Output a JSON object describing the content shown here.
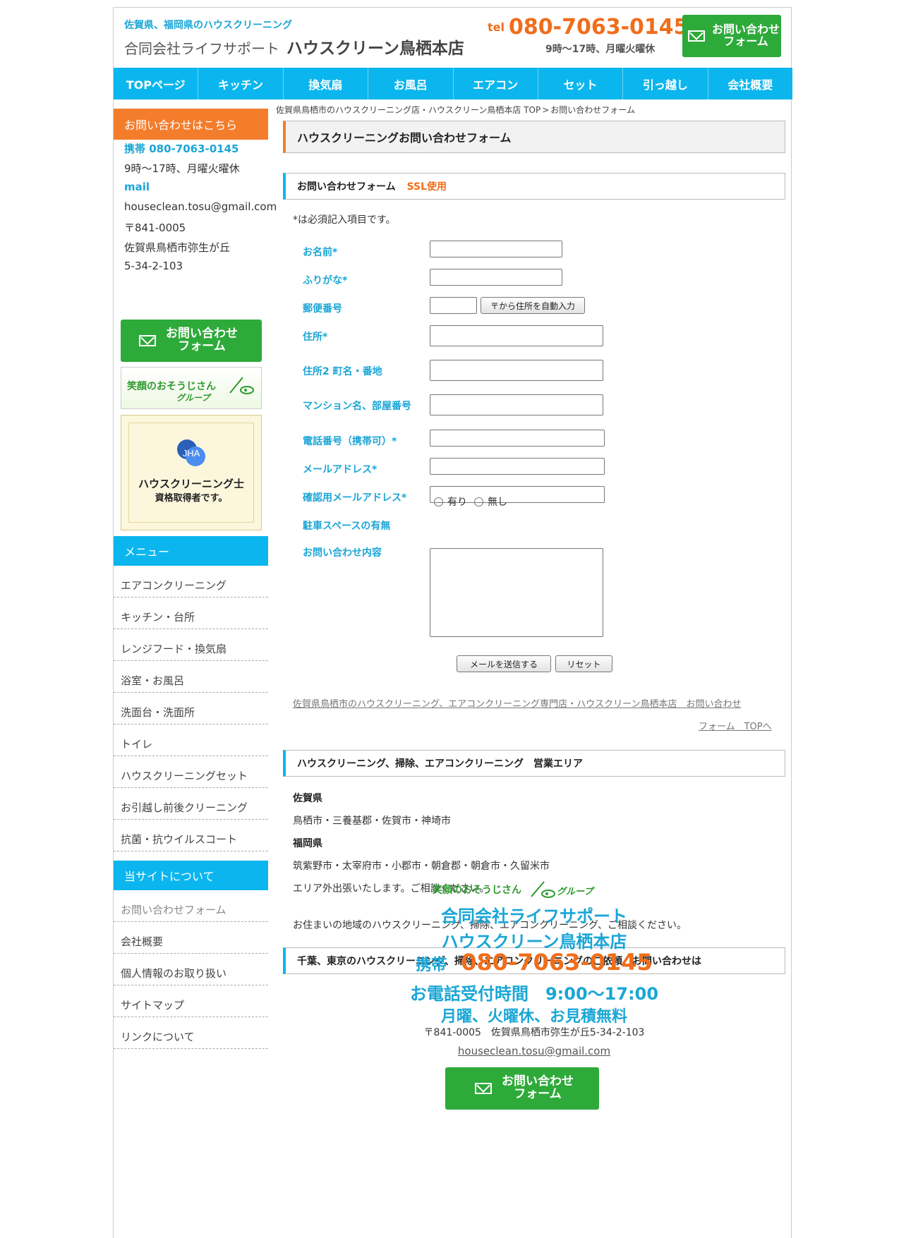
{
  "header": {
    "sub": "佐賀県、福岡県のハウスクリーニング",
    "company": "合同会社ライフサポート",
    "store": "ハウスクリーン鳥栖本店",
    "tel_prefix": "tel",
    "tel": "080-7063-0145",
    "hours": "9時～17時、月曜火曜休",
    "contact_btn": [
      "お問い合わせ",
      "フォーム"
    ]
  },
  "nav": [
    "TOPページ",
    "キッチン",
    "換気扇",
    "お風呂",
    "エアコン",
    "セット",
    "引っ越し",
    "会社概要"
  ],
  "sidebar": {
    "contact_head": "お問い合わせはこちら",
    "mobile": "携帯 080-7063-0145",
    "hours": "9時～17時、月曜火曜休",
    "mail_label": "mail",
    "email": "houseclean.tosu@gmail.com",
    "zip": "〒841-0005",
    "addr1": "佐賀県鳥栖市弥生が丘",
    "addr2": "5-34-2-103",
    "contact_btn": [
      "お問い合わせ",
      "フォーム"
    ],
    "banner1": {
      "main": "笑顔のおそうじさん",
      "sub": "グループ"
    },
    "banner2": {
      "logo": "JHA",
      "line1": "ハウスクリーニング士",
      "line2": "資格取得者です。"
    },
    "menu_head": "メニュー",
    "menu": [
      "エアコンクリーニング",
      "キッチン・台所",
      "レンジフード・換気扇",
      "浴室・お風呂",
      "洗面台・洗面所",
      "トイレ",
      "ハウスクリーニングセット",
      "お引越し前後クリーニング",
      "抗菌・抗ウイルスコート"
    ],
    "about_head": "当サイトについて",
    "about": [
      "お問い合わせフォーム",
      "会社概要",
      "個人情報のお取り扱い",
      "サイトマップ",
      "リンクについて"
    ]
  },
  "main": {
    "breadcrumb": [
      "佐賀県鳥栖市のハウスクリーニング店・ハウスクリーン鳥栖本店 TOP",
      "お問い合わせフォーム"
    ],
    "breadcrumb_sep": ">",
    "title": "ハウスクリーニングお問い合わせフォーム",
    "form_head": "お問い合わせフォーム",
    "ssl": "SSL使用",
    "req_note": "*は必須記入項目です。",
    "fields": {
      "name": "お名前*",
      "furigana": "ふりがな*",
      "zip": "郵便番号",
      "zip_btn": "〒から住所を自動入力",
      "addr": "住所*",
      "addr2": "住所2 町名・番地",
      "mansion": "マンション名、部屋番号",
      "tel": "電話番号（携帯可）*",
      "email": "メールアドレス*",
      "email_confirm": "確認用メールアドレス*",
      "parking": "駐車スペースの有無",
      "parking_yes": "有り",
      "parking_no": "無し",
      "message": "お問い合わせ内容"
    },
    "submit": "メールを送信する",
    "reset": "リセット",
    "back_link": [
      "佐賀県鳥栖市のハウスクリーニング、エアコンクリーニング専門店・ハウスクリーン鳥栖本店　お問い合わせ",
      "フォーム　TOPへ"
    ],
    "area_head": "ハウスクリーニング、掃除、エアコンクリーニング　営業エリア",
    "area": {
      "pref1": "佐賀県",
      "cities1": "鳥栖市・三養基郡・佐賀市・神埼市",
      "pref2": "福岡県",
      "cities2": "筑紫野市・太宰府市・小郡市・朝倉郡・朝倉市・久留米市",
      "note": "エリア外出張いたします。ご相談ください。",
      "consult": "お住まいの地域のハウスクリーニング、掃除、エアコンクリーニング、ご相談ください。"
    },
    "order_head": "千葉、東京のハウスクリーニング、掃除、エアコンクリーニングのご依頼、お問い合わせは"
  },
  "footer": {
    "logo_main": "笑顔のおそうじさん",
    "logo_sub": "グループ",
    "company": "合同会社ライフサポート",
    "store": "ハウスクリーン鳥栖本店",
    "mobile_label": "携帯",
    "tel": "080-7063-0145",
    "hours": "お電話受付時間　9:00～17:00",
    "closed": "月曜、火曜休、お見積無料",
    "addr": "〒841-0005　佐賀県鳥栖市弥生が丘5-34-2-103",
    "email": "houseclean.tosu@gmail.com",
    "contact_btn": [
      "お問い合わせ",
      "フォーム"
    ]
  },
  "colors": {
    "accent_blue": "#0bb6ee",
    "accent_orange": "#f47d2b",
    "green": "#2eaa3a"
  }
}
